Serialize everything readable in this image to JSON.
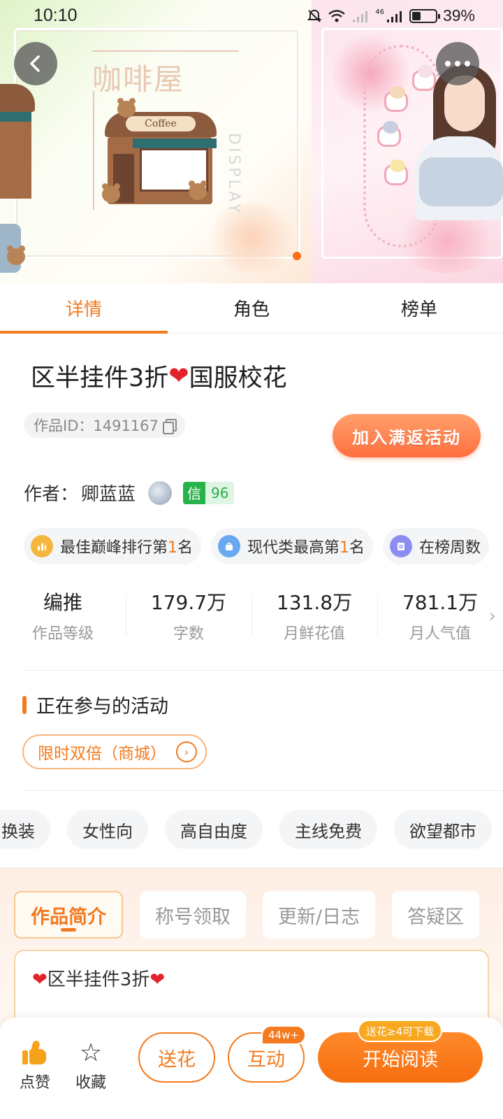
{
  "status_bar": {
    "time": "10:10",
    "battery_percent": "39%",
    "network_label": "46",
    "battery_level": 0.39
  },
  "banner": {
    "left_title": "咖啡屋",
    "left_vertical_text": "DISPLAY",
    "shop_sign": "Coffee",
    "active_slide": 1
  },
  "tabs": [
    {
      "label": "详情",
      "active": true
    },
    {
      "label": "角色",
      "active": false
    },
    {
      "label": "榜单",
      "active": false
    }
  ],
  "work": {
    "title_before_heart": "区半挂件3折",
    "title_after_heart": "国服校花",
    "id_text": "作品ID：1491167",
    "join_button": "加入满返活动",
    "author_label": "作者：",
    "author_name": "卿蓝蓝",
    "credit_label": "信",
    "credit_value": "96"
  },
  "ranks": [
    {
      "prefix": "最佳巅峰排行第",
      "num": "1",
      "suffix": "名",
      "icon": "bar-chart-icon"
    },
    {
      "prefix": "现代类最高第",
      "num": "1",
      "suffix": "名",
      "icon": "bag-icon"
    },
    {
      "prefix": "在榜周数",
      "num": "",
      "suffix": "",
      "icon": "list-icon"
    }
  ],
  "stats": [
    {
      "value": "编推",
      "label": "作品等级"
    },
    {
      "value": "179.7万",
      "label": "字数"
    },
    {
      "value": "131.8万",
      "label": "月鲜花值"
    },
    {
      "value": "781.1万",
      "label": "月人气值"
    }
  ],
  "activities": {
    "section_title": "正在参与的活动",
    "items": [
      "限时双倍（商城）"
    ]
  },
  "tags": [
    "换装",
    "女性向",
    "高自由度",
    "主线免费",
    "欲望都市"
  ],
  "subtabs": [
    {
      "label": "作品简介",
      "active": true
    },
    {
      "label": "称号领取",
      "active": false
    },
    {
      "label": "更新/日志",
      "active": false
    },
    {
      "label": "答疑区",
      "active": false
    }
  ],
  "intro": {
    "text": "区半挂件3折"
  },
  "bottom_bar": {
    "like_label": "点赞",
    "fav_label": "收藏",
    "flower_button": "送花",
    "interact_button": "互动",
    "interact_badge": "44w+",
    "read_button": "开始阅读",
    "read_badge": "送花≥4可下载"
  },
  "colors": {
    "accent": "#f37a1f",
    "heart": "#e2232b",
    "credit_green": "#27b24a"
  }
}
